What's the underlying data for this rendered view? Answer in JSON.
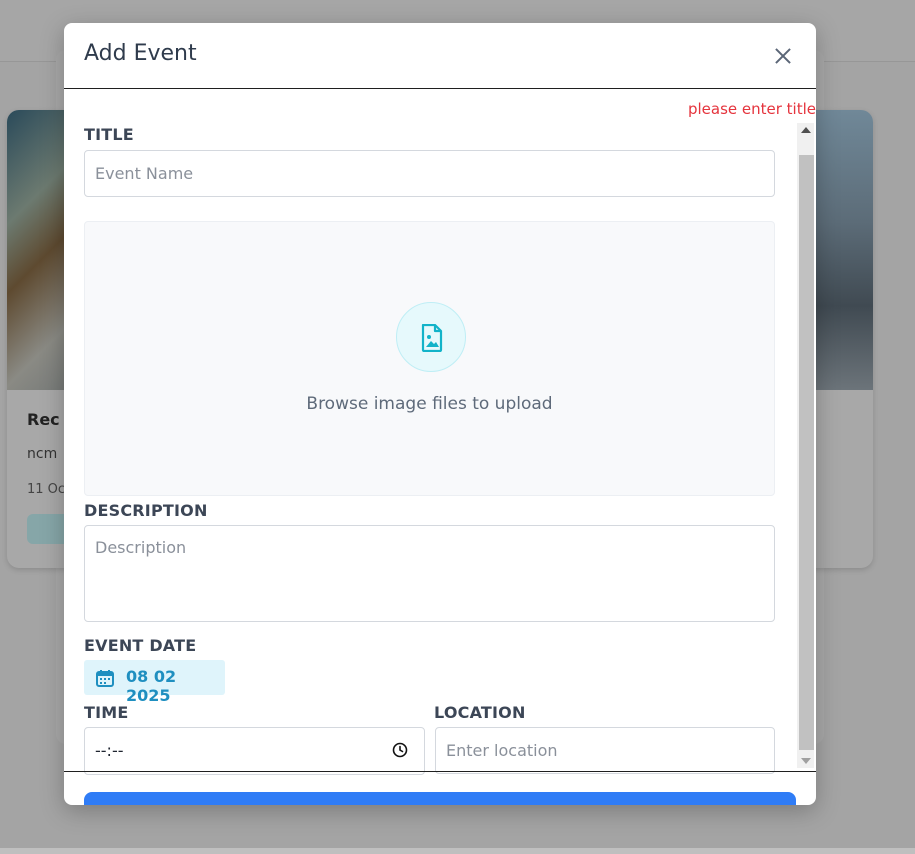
{
  "background": {
    "card_left": {
      "title": "Rec",
      "subtitle": "ncm",
      "date": "11 Oc"
    }
  },
  "modal": {
    "title": "Add Event",
    "error": "please enter title",
    "title_label": "TITLE",
    "title_placeholder": "Event Name",
    "upload_text": "Browse image files to upload",
    "description_label": "DESCRIPTION",
    "description_placeholder": "Description",
    "event_date_label": "EVENT DATE",
    "event_date_value": "08 02 2025",
    "time_label": "TIME",
    "time_value": "--:--",
    "location_label": "LOCATION",
    "location_placeholder": "Enter location"
  },
  "colors": {
    "accent": "#2f7cf6",
    "error": "#e5343d",
    "date_chip_text": "#1f8fc0",
    "upload_icon": "#12b3c9"
  },
  "icons": [
    "close-icon",
    "image-file-icon",
    "calendar-icon",
    "clock-icon"
  ]
}
